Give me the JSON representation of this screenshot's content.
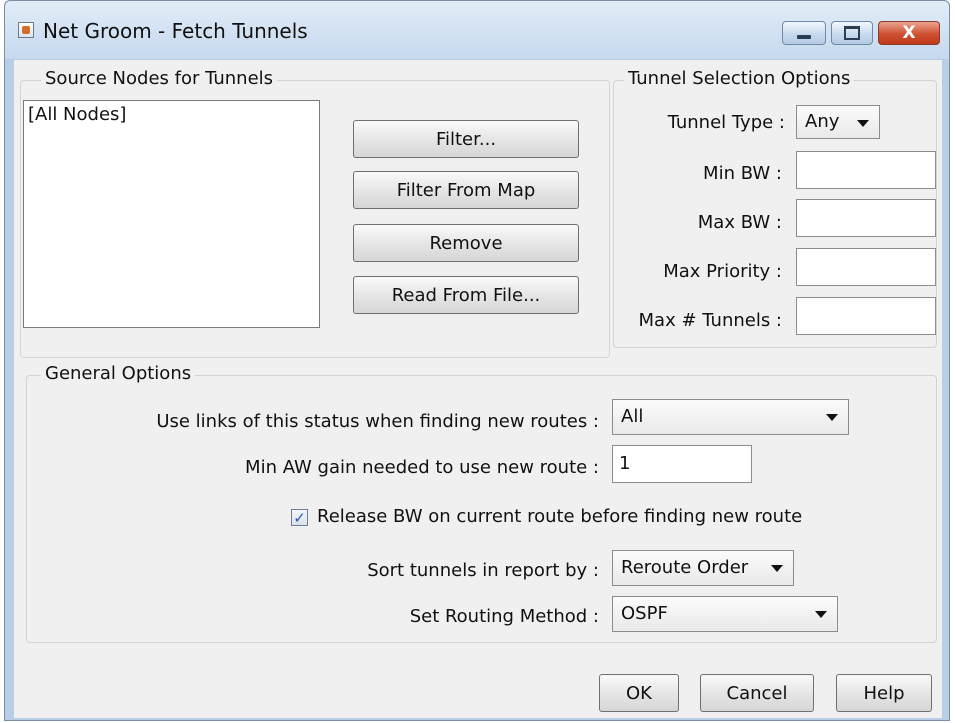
{
  "window": {
    "title": "Net Groom - Fetch Tunnels",
    "minimize_glyph": "",
    "maximize_glyph": "",
    "close_glyph": "X"
  },
  "source_nodes": {
    "title": "Source Nodes for Tunnels",
    "items": [
      "[All Nodes]"
    ],
    "buttons": {
      "filter": "Filter...",
      "filter_from_map": "Filter From Map",
      "remove": "Remove",
      "read_from_file": "Read From File..."
    }
  },
  "tunnel_selection": {
    "title": "Tunnel Selection Options",
    "tunnel_type_label": "Tunnel Type :",
    "tunnel_type_value": "Any",
    "min_bw_label": "Min BW :",
    "min_bw_value": "",
    "max_bw_label": "Max BW :",
    "max_bw_value": "",
    "max_priority_label": "Max Priority :",
    "max_priority_value": "",
    "max_tunnels_label": "Max # Tunnels :",
    "max_tunnels_value": ""
  },
  "general_options": {
    "title": "General Options",
    "link_status_label": "Use links of this status when finding new routes :",
    "link_status_value": "All",
    "min_aw_gain_label": "Min AW gain needed to use new route :",
    "min_aw_gain_value": "1",
    "release_bw_label": "Release BW on current route before finding new route",
    "release_bw_checked": true,
    "sort_label": "Sort tunnels in report by :",
    "sort_value": "Reroute Order",
    "routing_method_label": "Set Routing Method :",
    "routing_method_value": "OSPF"
  },
  "footer": {
    "ok": "OK",
    "cancel": "Cancel",
    "help": "Help"
  },
  "icons": {
    "app": "java-app-icon",
    "dropdown": "chevron-down-icon",
    "check": "checkmark-icon"
  }
}
